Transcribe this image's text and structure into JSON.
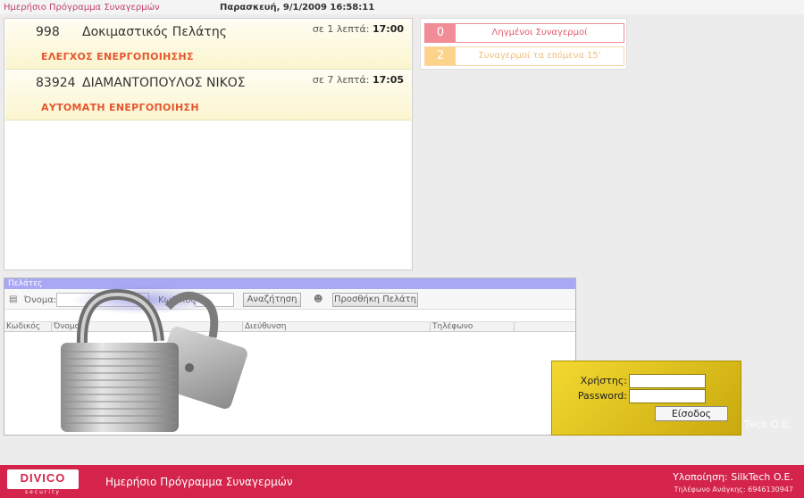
{
  "header": {
    "app_title": "Ημερήσιο Πρόγραμμα Συναγερμών",
    "datetime": "Παρασκευή, 9/1/2009 16:58:11"
  },
  "alarms": [
    {
      "code": "998",
      "name": "Δοκιμαστικός Πελάτης",
      "when_prefix": "σε 1 λεπτά:",
      "time": "17:00",
      "type": "ΕΛΕΓΧΟΣ ΕΝΕΡΓΟΠΟΙΗΣΗΣ"
    },
    {
      "code": "83924",
      "name": "ΔΙΑΜΑΝΤΟΠΟΥΛΟΣ ΝΙΚΟΣ",
      "when_prefix": "σε 7 λεπτά:",
      "time": "17:05",
      "type": "ΑΥΤΟΜΑΤΗ ΕΝΕΡΓΟΠΟΙΗΣΗ"
    }
  ],
  "status": {
    "missed_count": "0",
    "missed_label": "Ληγμένοι Συναγερμοί",
    "upcoming_count": "2",
    "upcoming_label": "Συναγερμοί τα επόμενα 15'"
  },
  "clients": {
    "header": "Πελάτες",
    "name_label": "Όνομα:",
    "code_label": "Κωδικός:",
    "search_button": "Αναζήτηση",
    "add_button": "Προσθήκη Πελάτη",
    "columns": [
      "Κωδικός",
      "Όνομα",
      "Διεύθυνση",
      "Τηλέφωνο"
    ]
  },
  "login": {
    "user_label": "Χρήστης:",
    "password_label": "Password:",
    "submit": "Είσοδος"
  },
  "watermark": "Tech O.E.",
  "footer": {
    "logo": "DIVICO",
    "logo_sub": "security",
    "title": "Ημερήσιο Πρόγραμμα Συναγερμών",
    "implementation": "Υλοποίηση: SilkTech O.E.",
    "emergency_phone": "Τηλέφωνο Ανάγκης: 6946130947"
  },
  "colors": {
    "accent": "#d4244b",
    "alarm_type": "#e4572e",
    "missed": "#f08d97",
    "upcoming": "#fbd38b",
    "login_bg": "#e8cc22"
  }
}
